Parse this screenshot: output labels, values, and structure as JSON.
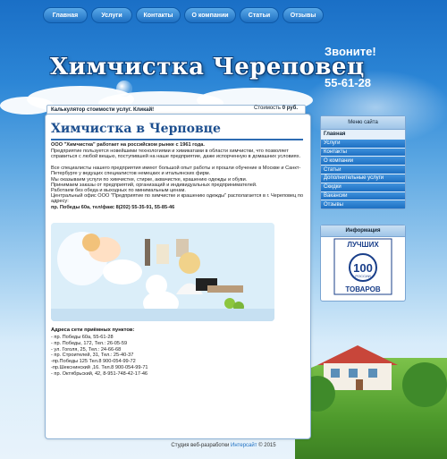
{
  "nav": {
    "items": [
      "Главная",
      "Услуги",
      "Контакты",
      "О компании",
      "Статьи",
      "Отзывы"
    ]
  },
  "header": {
    "title": "Химчистка Череповец",
    "call_label": "Звоните!",
    "phone": "55-61-28"
  },
  "calculator": {
    "label": "Калькулятор стоимости услуг. Кликай!",
    "cost_label": "Стоимость",
    "cost_value": "0 руб."
  },
  "main": {
    "title": "Химчистка в Черповце",
    "intro_bold": "ООО \"Химчистка\" работает на российском рынке с 1961 года.",
    "paragraphs": [
      "Предприятие пользуется новейшими технологиями и химикатами в области химчистки, что позволяет справиться с любой вещью, поступившей на наше предприятие, даже испорченную в домашних условиях.",
      "Все специалисты нашего предприятия имеют большой опыт работы и прошли обучение в Москве и Санкт-Петербурге у ведущих специалистов немецких и итальянских фирм.",
      "Мы оказываем услуги по химчистке, стирке, аквачистке, крашению одежды и обуви.",
      "Принимаем заказы от предприятий, организаций и индивидуальных предпринимателей.",
      "Работаем без обеда и выходных по минимальным ценам.",
      "Центральный офис ООО \"Предприятие по химчистке и крашению одежды\" располагается в г. Череповец по адресу:"
    ],
    "address_bold": "пр. Победы 60а, тел/факс 8(202) 55-35-91, 55-85-46",
    "addresses_title": "Адреса сети приёмных пунктов:",
    "addresses": [
      "- пр. Победы 60а, 55-61-28",
      "- пр. Победы, 172, Тел.: 26-05-59",
      "- ул. Гоголя, 25, Тел.: 24-66-68",
      "- пр. Строителей, 31, Тел.: 25-40-37",
      "-пр.Победы 125 Тел.8 900-054-99-72",
      "-пр.Шекснинский ,16. Тел.8 900-054-99-71",
      "- пр. Октябрьский, 42, 8-951-748-42-17-46"
    ]
  },
  "sidebar": {
    "menu_title": "Меню сайта",
    "items": [
      "Главная",
      "Услуги",
      "Контакты",
      "О компании",
      "Статьи",
      "Дополнительные услуги",
      "Скидки",
      "Вакансии",
      "Отзывы"
    ],
    "info_title": "Информация",
    "logo_top": "ЛУЧШИХ",
    "logo_mid": "РОССИИ",
    "logo_bottom": "ТОВАРОВ",
    "logo_number": "100"
  },
  "footer": {
    "prefix": "Студия веб-разработки",
    "studio": "Интерсайт",
    "suffix": "© 2015"
  }
}
